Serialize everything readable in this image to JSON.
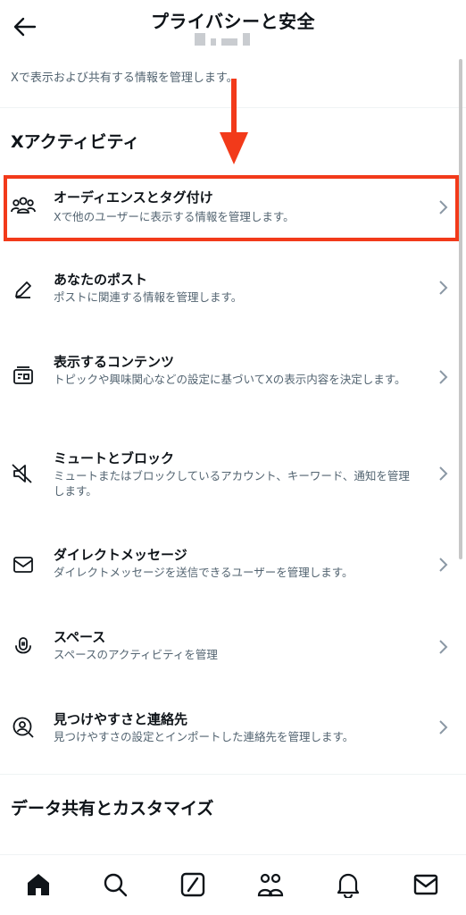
{
  "header": {
    "title": "プライバシーと安全",
    "back_icon": "arrow-left-icon"
  },
  "subtitle": "Xで表示および共有する情報を管理します。",
  "sections": [
    {
      "title": "Xアクティビティ"
    },
    {
      "title": "データ共有とカスタマイズ"
    }
  ],
  "items": [
    {
      "label": "オーディエンスとタグ付け",
      "desc": "Xで他のユーザーに表示する情報を管理します。",
      "icon": "people-icon"
    },
    {
      "label": "あなたのポスト",
      "desc": "ポストに関連する情報を管理します。",
      "icon": "pencil-icon"
    },
    {
      "label": "表示するコンテンツ",
      "desc": "トピックや興味関心などの設定に基づいてXの表示内容を決定します。",
      "icon": "content-icon"
    },
    {
      "label": "ミュートとブロック",
      "desc": "ミュートまたはブロックしているアカウント、キーワード、通知を管理します。",
      "icon": "mute-icon"
    },
    {
      "label": "ダイレクトメッセージ",
      "desc": "ダイレクトメッセージを送信できるユーザーを管理します。",
      "icon": "envelope-icon"
    },
    {
      "label": "スペース",
      "desc": "スペースのアクティビティを管理",
      "icon": "spaces-icon"
    },
    {
      "label": "見つけやすさと連絡先",
      "desc": "見つけやすさの設定とインポートした連絡先を管理します。",
      "icon": "discover-icon"
    }
  ],
  "annotation": {
    "color": "#f23a1a"
  },
  "nav": [
    "home-icon",
    "search-icon",
    "grok-icon",
    "communities-icon",
    "bell-icon",
    "mail-icon"
  ]
}
